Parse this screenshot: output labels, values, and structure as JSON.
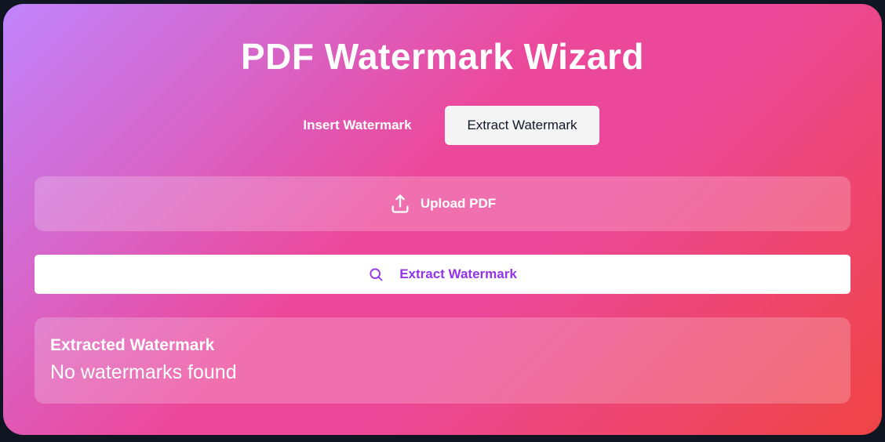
{
  "title": "PDF Watermark Wizard",
  "tabs": [
    {
      "label": "Insert Watermark",
      "active": false
    },
    {
      "label": "Extract Watermark",
      "active": true
    }
  ],
  "upload": {
    "label": "Upload PDF",
    "icon": "upload-icon"
  },
  "extract_button": {
    "label": "Extract Watermark",
    "icon": "search-icon"
  },
  "result": {
    "heading": "Extracted Watermark",
    "text": "No watermarks found"
  },
  "colors": {
    "gradient_start": "#c084fc",
    "gradient_mid": "#ec4899",
    "gradient_end": "#ef4444",
    "extract_button_text": "#9333ea",
    "active_tab_bg": "#f4f4f5"
  }
}
